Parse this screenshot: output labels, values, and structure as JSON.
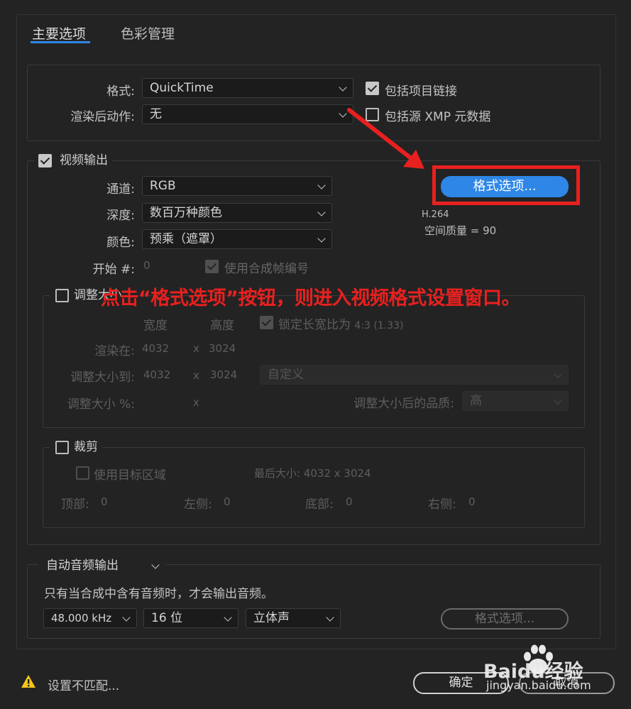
{
  "tabs": [
    "主要选项",
    "色彩管理"
  ],
  "top": {
    "format_label": "格式:",
    "format_value": "QuickTime",
    "post_render_label": "渲染后动作:",
    "post_render_value": "无",
    "include_project_link": "包括项目链接",
    "include_xmp": "包括源 XMP 元数据"
  },
  "video": {
    "header": "视频输出",
    "channels_label": "通道:",
    "channels_value": "RGB",
    "depth_label": "深度:",
    "depth_value": "数百万种颜色",
    "color_label": "颜色:",
    "color_value": "预乘（遮罩）",
    "start_label": "开始 #:",
    "start_value": "0",
    "use_comp_frame": "使用合成帧编号",
    "format_options_button": "格式选项...",
    "codec": "H.264",
    "quality": "空间质量 = 90"
  },
  "annotation": "点击“格式选项”按钮，则进入视频格式设置窗口。",
  "resize": {
    "header": "调整大小",
    "width_header": "宽度",
    "height_header": "高度",
    "lock_aspect": "锁定长宽比为",
    "lock_aspect_value": "4:3 (1.33)",
    "rendering_at_label": "渲染在:",
    "rendering_at_w": "4032",
    "rendering_at_h": "3024",
    "resize_to_label": "调整大小到:",
    "resize_to_w": "4032",
    "resize_to_h": "3024",
    "preset_value": "自定义",
    "resize_pct_label": "调整大小 %:",
    "x": "x",
    "quality_label": "调整大小后的品质:",
    "quality_value": "高"
  },
  "crop": {
    "header": "裁剪",
    "use_roi": "使用目标区域",
    "final_size": "最后大小: 4032 x 3024",
    "top_label": "顶部:",
    "top_value": "0",
    "left_label": "左侧:",
    "left_value": "0",
    "bottom_label": "底部:",
    "bottom_value": "0",
    "right_label": "右侧:",
    "right_value": "0"
  },
  "audio": {
    "output_value": "自动音频输出",
    "note": "只有当合成中含有音频时，才会输出音频。",
    "rate": "48.000 kHz",
    "bits": "16 位",
    "channels": "立体声",
    "format_options_button": "格式选项..."
  },
  "footer": {
    "warning": "设置不匹配...",
    "ok": "确定",
    "cancel": "取消"
  },
  "watermark": {
    "brand": "Baidu经验",
    "url": "jingyan.baidu.com"
  },
  "colors": {
    "accent_blue": "#2e86e6",
    "highlight_red": "#e8201f",
    "warning_yellow": "#f5c518"
  }
}
